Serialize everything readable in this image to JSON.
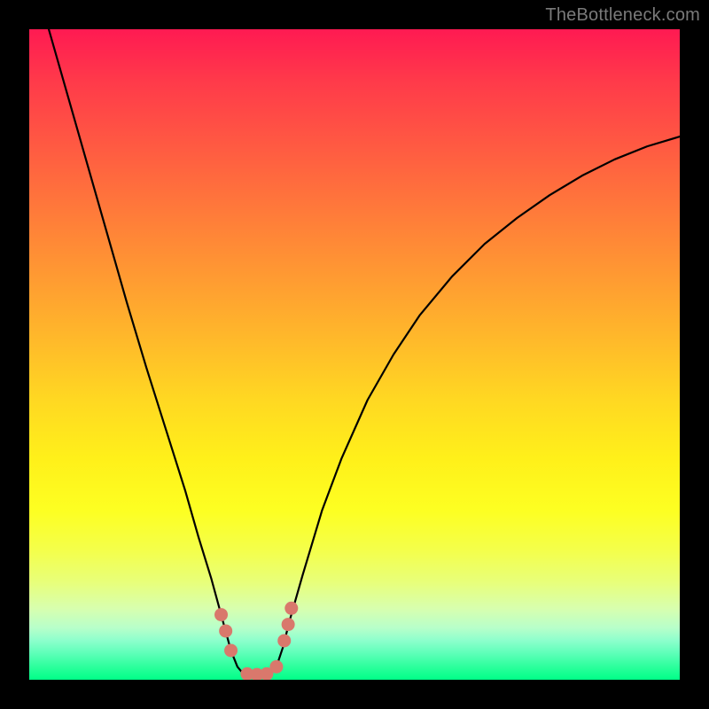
{
  "watermark": {
    "text": "TheBottleneck.com"
  },
  "chart_data": {
    "type": "line",
    "title": "",
    "xlabel": "",
    "ylabel": "",
    "xlim": [
      0,
      100
    ],
    "ylim": [
      0,
      100
    ],
    "series": [
      {
        "name": "bottleneck-curve",
        "x": [
          3.0,
          6.0,
          9.0,
          12.0,
          15.0,
          18.0,
          21.0,
          24.0,
          26.0,
          28.0,
          29.5,
          31.0,
          32.0,
          33.0,
          34.0,
          35.0,
          36.0,
          37.0,
          38.0,
          39.0,
          40.0,
          42.0,
          45.0,
          48.0,
          52.0,
          56.0,
          60.0,
          65.0,
          70.0,
          75.0,
          80.0,
          85.0,
          90.0,
          95.0,
          100.0
        ],
        "y": [
          100.0,
          89.5,
          79.0,
          68.5,
          58.0,
          48.0,
          38.5,
          29.0,
          22.0,
          15.5,
          10.0,
          4.5,
          2.0,
          0.8,
          0.4,
          0.3,
          0.4,
          0.8,
          2.0,
          5.0,
          9.0,
          16.0,
          26.0,
          34.0,
          43.0,
          50.0,
          56.0,
          62.0,
          67.0,
          71.0,
          74.5,
          77.5,
          80.0,
          82.0,
          83.5
        ]
      }
    ],
    "optimal_zone": {
      "x_start": 29.5,
      "x_end": 40.0
    },
    "markers": [
      {
        "x": 29.5,
        "y": 10.0
      },
      {
        "x": 30.2,
        "y": 7.5
      },
      {
        "x": 31.0,
        "y": 4.5
      },
      {
        "x": 33.5,
        "y": 0.9
      },
      {
        "x": 35.0,
        "y": 0.8
      },
      {
        "x": 36.5,
        "y": 0.9
      },
      {
        "x": 38.0,
        "y": 2.0
      },
      {
        "x": 39.2,
        "y": 6.0
      },
      {
        "x": 39.8,
        "y": 8.5
      },
      {
        "x": 40.3,
        "y": 11.0
      }
    ],
    "colors": {
      "curve": "#000000",
      "marker": "#d9786c",
      "gradient_top": "#ff1a52",
      "gradient_bottom": "#00ff88"
    }
  }
}
